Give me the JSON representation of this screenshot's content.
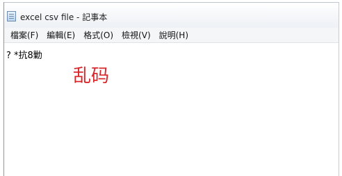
{
  "window": {
    "title": "excel csv file - 記事本",
    "icon": "notepad-icon"
  },
  "menu": {
    "items": [
      {
        "label": "檔案(F)"
      },
      {
        "label": "編輯(E)"
      },
      {
        "label": "格式(O)"
      },
      {
        "label": "檢視(V)"
      },
      {
        "label": "說明(H)"
      }
    ]
  },
  "editor": {
    "content": "? *抗8勦"
  },
  "annotation": {
    "text": "乱码",
    "color": "#d8262a"
  }
}
